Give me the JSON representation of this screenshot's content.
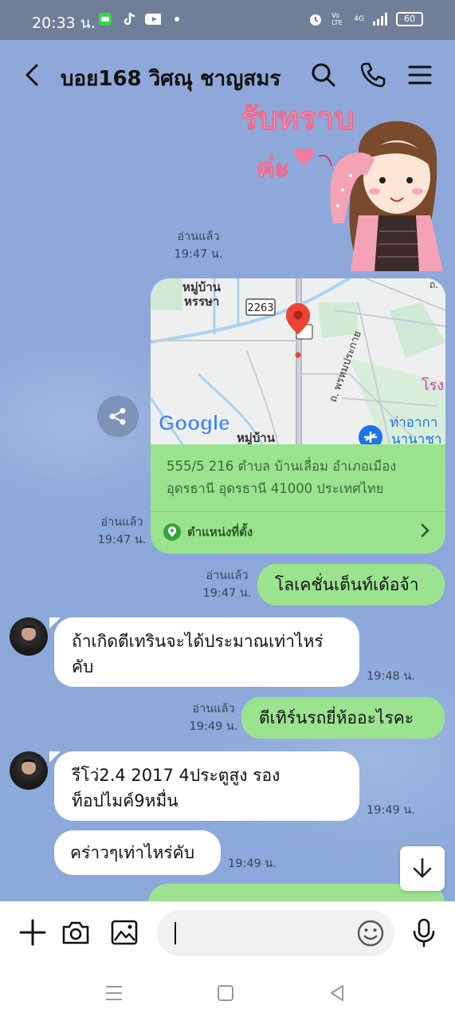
{
  "status_bar": {
    "time": "20:33 น.",
    "network": "4G",
    "volte": "Vo LTE",
    "battery": "60",
    "app_icons": [
      "line-app-icon",
      "tiktok-icon",
      "youtube-icon",
      "dot-icon"
    ]
  },
  "header": {
    "title": "บอย168 วิศณุ ชาญสมร",
    "icons": [
      "back-icon",
      "search-icon",
      "phone-icon",
      "menu-icon"
    ]
  },
  "sticker": {
    "text_line1": "รับทราบ",
    "text_line2": "ค่ะ"
  },
  "messages": [
    {
      "type": "sticker",
      "read_label": "อ่านแล้ว",
      "time": "19:47 น."
    },
    {
      "type": "location",
      "map": {
        "village_label_1": "หมู่บ้าน",
        "village_label_2": "หรรษา",
        "road_number": "2263",
        "road_name": "ถ. พรหมประกาย",
        "brand": "Google",
        "bottom_village": "หมู่บ้าน",
        "airport_1": "ท่าอากา",
        "airport_2": "นานาชา",
        "pink_label": "โรง",
        "corner_label": "ถ."
      },
      "address": "555/5 216 ตำบล บ้านเลื่อม อำเภอเมือง อุดรธานี อุดรธานี 41000 ประเทศไทย",
      "location_label": "ตำแหน่งที่ตั้ง",
      "read_label": "อ่านแล้ว",
      "time": "19:47 น."
    },
    {
      "type": "text_out",
      "text": "โลเคชั่นเต็นท์เด้อจ้า",
      "read_label": "อ่านแล้ว",
      "time": "19:47 น."
    },
    {
      "type": "text_in",
      "text": "ถ้าเกิดตีเทรินจะได้ประมาณเท่าไหร่คับ",
      "time": "19:48 น."
    },
    {
      "type": "text_out",
      "text": "ตีเทิร์นรถยี่ห้ออะไรคะ",
      "read_label": "อ่านแล้ว",
      "time": "19:49 น."
    },
    {
      "type": "text_in",
      "text": "รีโว่2.4 2017 4ประตูสูง รองท็อปไมค์9หมื่น",
      "time": "19:49 น."
    },
    {
      "type": "text_in",
      "text": "คร่าวๆเท่าไหร่คับ",
      "time": "19:49 น."
    }
  ],
  "composer": {
    "icons": [
      "plus-icon",
      "camera-icon",
      "image-icon",
      "emoji-icon",
      "microphone-icon"
    ],
    "value": ""
  },
  "nav": {
    "icons": [
      "recent-apps-icon",
      "home-icon",
      "back-nav-icon"
    ]
  },
  "colors": {
    "chat_background": "#8ba9da",
    "outgoing_bubble": "#9be38f",
    "incoming_bubble": "#ffffff",
    "status_bar": "#6f7f97",
    "map_pin": "#ea4335"
  }
}
